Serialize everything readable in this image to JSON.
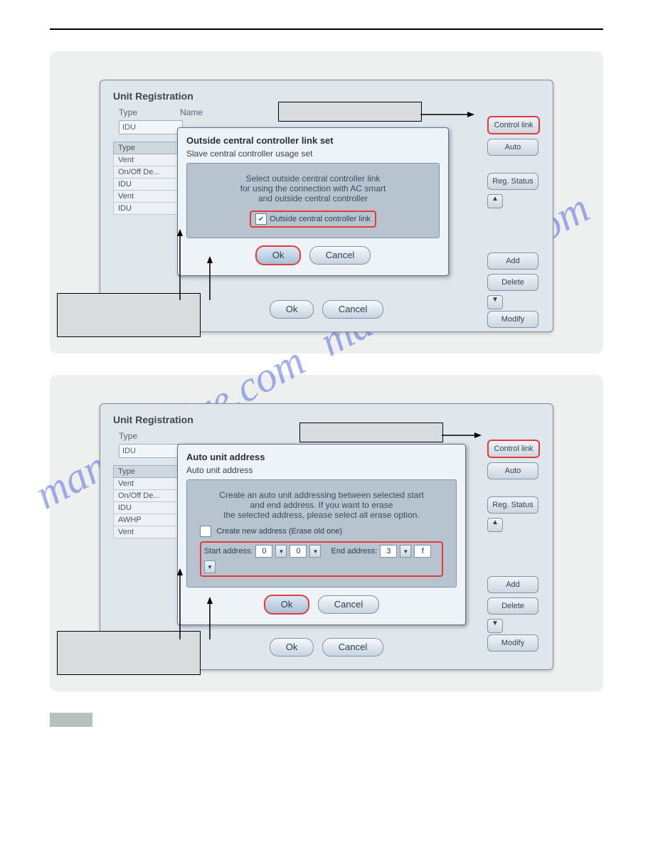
{
  "fig1": {
    "window_title": "Unit Registration",
    "labels": {
      "type": "Type",
      "name": "Name",
      "type_col": "Type"
    },
    "type_value": "IDU",
    "types": [
      "Vent",
      "On/Off De...",
      "IDU",
      "Vent",
      "IDU"
    ],
    "side": {
      "control_link": "Control link",
      "auto": "Auto",
      "reg_status": "Reg. Status",
      "add": "Add",
      "delete": "Delete",
      "modify": "Modify"
    },
    "bottom": {
      "ok": "Ok",
      "cancel": "Cancel"
    },
    "modal": {
      "title": "Outside central controller link set",
      "sub": "Slave central controller usage set",
      "line1": "Select outside central controller link",
      "line2": "for using the connection with AC smart",
      "line3": "and outside central controller",
      "checkbox_label": "Outside central controller link",
      "ok": "Ok",
      "cancel": "Cancel"
    }
  },
  "fig2": {
    "window_title": "Unit Registration",
    "labels": {
      "type": "Type",
      "type_col": "Type"
    },
    "type_value": "IDU",
    "types": [
      "Vent",
      "On/Off De...",
      "IDU",
      "AWHP",
      "Vent"
    ],
    "side": {
      "control_link": "Control link",
      "auto": "Auto",
      "reg_status": "Reg. Status",
      "add": "Add",
      "delete": "Delete",
      "modify": "Modify"
    },
    "bottom": {
      "ok": "Ok",
      "cancel": "Cancel"
    },
    "modal": {
      "title": "Auto unit address",
      "sub": "Auto unit address",
      "line1": "Create an auto unit addressing between selected start",
      "line2": "and end address. If you want to erase",
      "line3": "the selected address, please select all erase option.",
      "checkbox_label": "Create new address (Erase old one)",
      "start_label": "Start address:",
      "end_label": "End address:",
      "start_hi": "0",
      "start_lo": "0",
      "end_hi": "3",
      "end_lo": "f",
      "ok": "Ok",
      "cancel": "Cancel"
    }
  },
  "watermark": "manualshive.com"
}
